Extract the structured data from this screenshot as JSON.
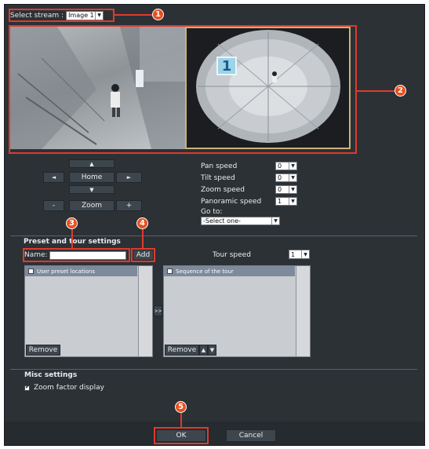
{
  "stream": {
    "label": "Select stream :",
    "value": "Image 1"
  },
  "camera": {
    "overlay_number": "1"
  },
  "ptz": {
    "up": "▲",
    "left": "◄",
    "home": "Home",
    "right": "►",
    "down": "▼",
    "zoom_out": "-",
    "zoom": "Zoom",
    "zoom_in": "+"
  },
  "speeds": [
    {
      "label": "Pan speed",
      "value": "0"
    },
    {
      "label": "Tilt speed",
      "value": "0"
    },
    {
      "label": "Zoom speed",
      "value": "0"
    },
    {
      "label": "Panoramic speed",
      "value": "1"
    }
  ],
  "goto": {
    "label": "Go to:",
    "value": "-Select one-"
  },
  "preset": {
    "title": "Preset and tour settings",
    "name_label": "Name:",
    "name_value": "",
    "add": "Add",
    "tour_speed_label": "Tour speed",
    "tour_speed_value": "1",
    "user_locations": "User preset locations",
    "remove": "Remove",
    "move": ">>",
    "sequence": "Sequence of the tour",
    "remove2": "Remove",
    "up": "▲",
    "down": "▼"
  },
  "misc": {
    "title": "Misc settings",
    "zoom_display": "Zoom factor display"
  },
  "footer": {
    "ok": "OK",
    "cancel": "Cancel"
  },
  "callouts": [
    "1",
    "2",
    "3",
    "4",
    "5"
  ],
  "colors": {
    "callout": "#e8501e",
    "highlight": "#e03a2c",
    "background": "#2c3136"
  }
}
